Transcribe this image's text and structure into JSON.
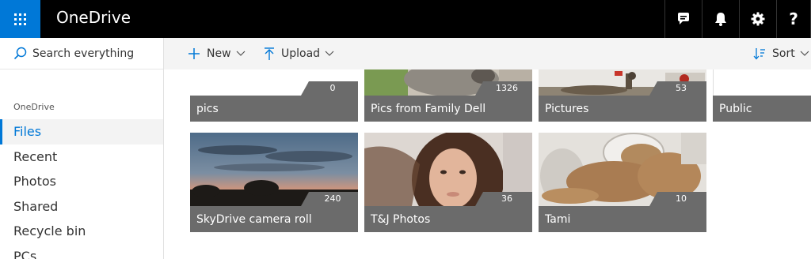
{
  "app": {
    "title": "OneDrive"
  },
  "header_icons": [
    "chat-icon",
    "bell-icon",
    "gear-icon",
    "help-icon"
  ],
  "help_glyph": "?",
  "search": {
    "placeholder": "Search everything"
  },
  "nav": {
    "heading": "OneDrive",
    "items": [
      {
        "label": "Files",
        "active": true
      },
      {
        "label": "Recent"
      },
      {
        "label": "Photos"
      },
      {
        "label": "Shared"
      },
      {
        "label": "Recycle bin"
      },
      {
        "label": "PCs"
      }
    ]
  },
  "commands": {
    "new_label": "New",
    "upload_label": "Upload",
    "sort_label": "Sort"
  },
  "tiles": [
    {
      "name": "pics",
      "count": "0"
    },
    {
      "name": "Pics from Family Dell",
      "count": "1326"
    },
    {
      "name": "Pictures",
      "count": "53"
    },
    {
      "name": "Public",
      "count": ""
    },
    {
      "name": "SkyDrive camera roll",
      "count": "240"
    },
    {
      "name": "T&J Photos",
      "count": "36"
    },
    {
      "name": "Tami",
      "count": "10"
    }
  ],
  "colors": {
    "accent": "#0078d7",
    "topbar": "#000000",
    "tile_band": "#6b6b6b",
    "command_bar": "#f4f4f4"
  }
}
